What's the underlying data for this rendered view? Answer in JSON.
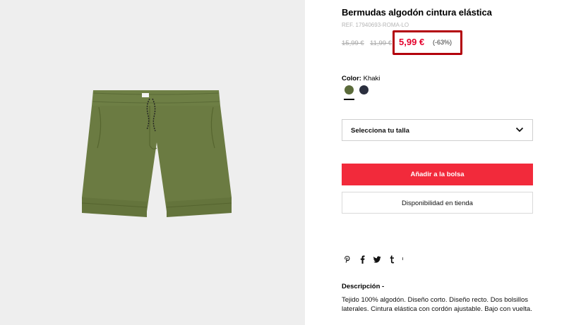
{
  "product": {
    "title": "Bermudas algodón cintura elástica",
    "ref": "REF. 17940693-ROMA-LO",
    "price_original": "15,99 €",
    "price_previous": "11,99 €",
    "price_sale": "5,99 €",
    "discount": "(-63%)",
    "image_icon": "khaki-shorts-image",
    "accent_color": "#f22a3b",
    "sale_color": "#e4002b"
  },
  "color": {
    "label": "Color:",
    "value": "Khaki",
    "swatches": [
      {
        "name": "Khaki",
        "hex": "#5b6b3a",
        "selected": true
      },
      {
        "name": "Navy",
        "hex": "#2b2f3e",
        "selected": false
      }
    ]
  },
  "size": {
    "label": "Selecciona tu talla",
    "icon": "chevron-down-icon"
  },
  "actions": {
    "add_to_bag": "Añadir a la bolsa",
    "store_availability": "Disponibilidad en tienda"
  },
  "share": {
    "icons": [
      "pinterest-icon",
      "facebook-icon",
      "twitter-icon",
      "tumblr-icon"
    ]
  },
  "description": {
    "title": "Descripción -",
    "text": "Tejido 100% algodón. Diseño corto. Diseño recto. Dos bolsillos laterales. Cintura elástica con cordón ajustable. Bajo con vuelta."
  }
}
